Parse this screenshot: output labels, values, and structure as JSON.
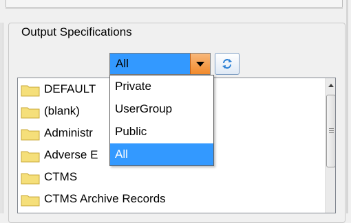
{
  "group": {
    "title": "Output Specifications"
  },
  "filter": {
    "selected": "All",
    "refresh_icon": "refresh-icon"
  },
  "dropdown": {
    "options": [
      "Private",
      "UserGroup",
      "Public",
      "All"
    ],
    "selected_index": 3
  },
  "list": {
    "items": [
      "DEFAULT",
      "(blank)",
      "Administr",
      "Adverse E",
      "CTMS",
      "CTMS Archive Records"
    ],
    "folder_icon": "folder-icon"
  },
  "colors": {
    "selection": "#3399ff",
    "arrow_button": "#f28a2b",
    "refresh_arrows": "#2a7fd4",
    "folder": "#f5df7a"
  }
}
